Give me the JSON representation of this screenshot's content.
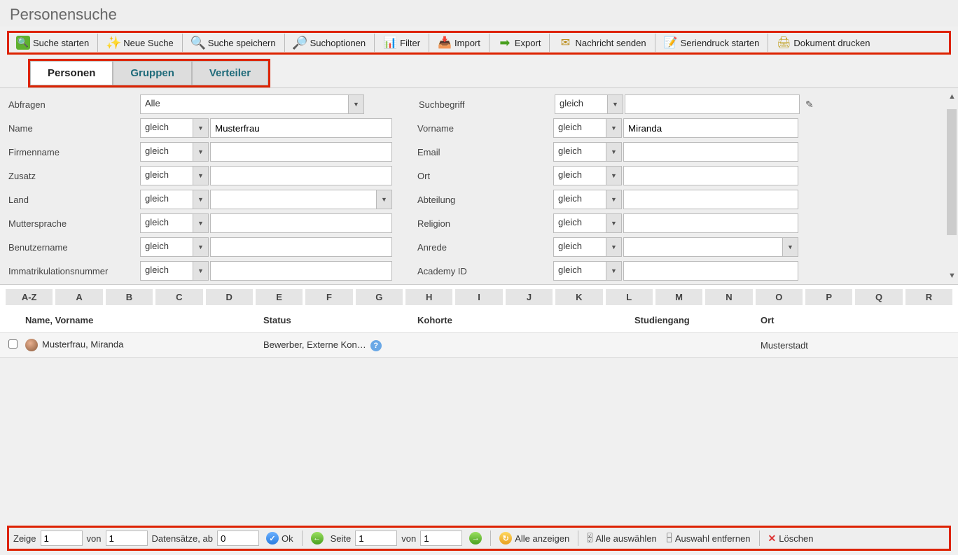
{
  "page_title": "Personensuche",
  "toolbar": [
    {
      "name": "search-start",
      "label": "Suche starten",
      "icon": "search-icon",
      "cls": "ic-search",
      "glyph": "🔍"
    },
    {
      "name": "new-search",
      "label": "Neue Suche",
      "icon": "star-icon",
      "cls": "ic-star",
      "glyph": "✨"
    },
    {
      "name": "save-search",
      "label": "Suche speichern",
      "icon": "save-search-icon",
      "cls": "ic-save",
      "glyph": "🔍"
    },
    {
      "name": "search-options",
      "label": "Suchoptionen",
      "icon": "options-icon",
      "cls": "ic-opt",
      "glyph": "🔎"
    },
    {
      "name": "filter",
      "label": "Filter",
      "icon": "filter-icon",
      "cls": "ic-filter",
      "glyph": "📊"
    },
    {
      "name": "import",
      "label": "Import",
      "icon": "import-icon",
      "cls": "ic-import",
      "glyph": "📥"
    },
    {
      "name": "export",
      "label": "Export",
      "icon": "export-icon",
      "cls": "ic-export",
      "glyph": "➡"
    },
    {
      "name": "send-message",
      "label": "Nachricht senden",
      "icon": "message-icon",
      "cls": "ic-msg",
      "glyph": "✉"
    },
    {
      "name": "serial-print",
      "label": "Seriendruck starten",
      "icon": "serial-print-icon",
      "cls": "ic-print",
      "glyph": "📝"
    },
    {
      "name": "print-document",
      "label": "Dokument drucken",
      "icon": "document-icon",
      "cls": "ic-doc",
      "glyph": "🖨"
    }
  ],
  "tabs": [
    {
      "name": "tab-personen",
      "label": "Personen",
      "active": true
    },
    {
      "name": "tab-gruppen",
      "label": "Gruppen",
      "active": false
    },
    {
      "name": "tab-verteiler",
      "label": "Verteiler",
      "active": false
    }
  ],
  "form": {
    "abfragen_label": "Abfragen",
    "abfragen_value": "Alle",
    "suchbegriff_label": "Suchbegriff",
    "op_gleich": "gleich",
    "rows": [
      {
        "l_label": "Name",
        "l_op": "gleich",
        "l_val": "Musterfrau",
        "l_type": "text",
        "r_label": "Vorname",
        "r_op": "gleich",
        "r_val": "Miranda",
        "r_type": "text"
      },
      {
        "l_label": "Firmenname",
        "l_op": "gleich",
        "l_val": "",
        "l_type": "text",
        "r_label": "Email",
        "r_op": "gleich",
        "r_val": "",
        "r_type": "text"
      },
      {
        "l_label": "Zusatz",
        "l_op": "gleich",
        "l_val": "",
        "l_type": "text",
        "r_label": "Ort",
        "r_op": "gleich",
        "r_val": "",
        "r_type": "text"
      },
      {
        "l_label": "Land",
        "l_op": "gleich",
        "l_val": "",
        "l_type": "select",
        "r_label": "Abteilung",
        "r_op": "gleich",
        "r_val": "",
        "r_type": "text"
      },
      {
        "l_label": "Muttersprache",
        "l_op": "gleich",
        "l_val": "",
        "l_type": "text",
        "r_label": "Religion",
        "r_op": "gleich",
        "r_val": "",
        "r_type": "text"
      },
      {
        "l_label": "Benutzername",
        "l_op": "gleich",
        "l_val": "",
        "l_type": "text",
        "r_label": "Anrede",
        "r_op": "gleich",
        "r_val": "",
        "r_type": "select"
      },
      {
        "l_label": "Immatrikulationsnummer",
        "l_op": "gleich",
        "l_val": "",
        "l_type": "text",
        "r_label": "Academy ID",
        "r_op": "gleich",
        "r_val": "",
        "r_type": "text"
      }
    ]
  },
  "alphabet": [
    "A-Z",
    "A",
    "B",
    "C",
    "D",
    "E",
    "F",
    "G",
    "H",
    "I",
    "J",
    "K",
    "L",
    "M",
    "N",
    "O",
    "P",
    "Q",
    "R"
  ],
  "table": {
    "headers": {
      "name": "Name, Vorname",
      "status": "Status",
      "kohorte": "Kohorte",
      "studiengang": "Studiengang",
      "ort": "Ort"
    },
    "rows": [
      {
        "name": "Musterfrau, Miranda",
        "status": "Bewerber, Externe Kon…",
        "kohorte": "",
        "studiengang": "",
        "ort": "Musterstadt"
      }
    ]
  },
  "footer": {
    "zeige": "Zeige",
    "zeige_val": "1",
    "von": "von",
    "von_val": "1",
    "datensaetze": "Datensätze, ab",
    "ab_val": "0",
    "ok": "Ok",
    "seite": "Seite",
    "seite_val": "1",
    "von2": "von",
    "von2_val": "1",
    "alle_anzeigen": "Alle anzeigen",
    "alle_auswaehlen": "Alle auswählen",
    "auswahl_entfernen": "Auswahl entfernen",
    "loeschen": "Löschen"
  }
}
